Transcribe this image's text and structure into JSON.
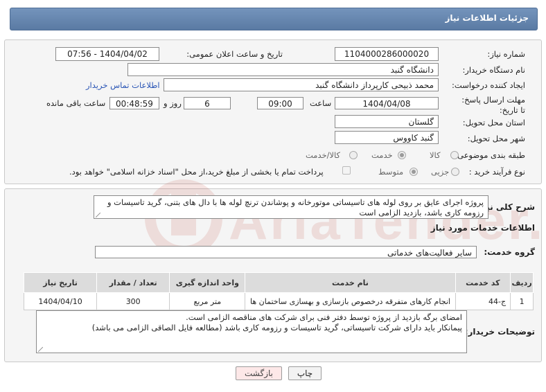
{
  "header": {
    "title": "جزئیات اطلاعات نیاز"
  },
  "need": {
    "number_label": "شماره نیاز:",
    "number": "1104000286000020",
    "announce_label": "تاریخ و ساعت اعلان عمومی:",
    "announce_value": "1404/04/02 - 07:56",
    "buyer_label": "نام دستگاه خریدار:",
    "buyer": "دانشگاه گنبد",
    "creator_label": "ایجاد کننده درخواست:",
    "creator": "محمد ذبیحی کارپرداز دانشگاه گنبد",
    "contact_link": "اطلاعات تماس خریدار",
    "deadline_label": "مهلت ارسال پاسخ: تا تاریخ:",
    "deadline_date": "1404/04/08",
    "time_label": "ساعت",
    "deadline_time": "09:00",
    "days_value": "6",
    "days_label": "روز و",
    "remaining_value": "00:48:59",
    "remaining_label": "ساعت باقی مانده",
    "province_label": "استان محل تحویل:",
    "province": "گلستان",
    "city_label": "شهر محل تحویل:",
    "city": "گنبد کاووس",
    "category_label": "طبقه بندی موضوعی:",
    "category_options": [
      "کالا",
      "خدمت",
      "کالا/خدمت"
    ],
    "category_selected": "خدمت",
    "process_label": "نوع فرآیند خرید :",
    "process_options": [
      "جزیی",
      "متوسط"
    ],
    "process_selected": "متوسط",
    "payment_note": "پرداخت تمام یا بخشی از مبلغ خرید،از محل \"اسناد خزانه اسلامی\" خواهد بود."
  },
  "summary": {
    "label": "شرح کلی نیاز:",
    "text": "پروژه اجرای عایق بر روی لوله های تاسیساتی موتورخانه و پوشاندن ترنچ لوله ها با دال های بتنی، گرید تاسیسات و رزومه کاری باشد، بازدید الزامی است"
  },
  "services": {
    "section_title": "اطلاعات خدمات مورد نیاز",
    "group_label": "گروه خدمت:",
    "group_value": "سایر فعالیت‌های خدماتی",
    "columns": [
      "ردیف",
      "کد خدمت",
      "نام خدمت",
      "واحد اندازه گیری",
      "تعداد / مقدار",
      "تاریخ نیاز"
    ],
    "rows": [
      [
        "1",
        "ج-44",
        "انجام کارهای متفرقه درخصوص بازسازی و بهسازی ساختمان ها",
        "متر مربع",
        "300",
        "1404/04/10"
      ]
    ]
  },
  "buyer_notes": {
    "label": "توضیحات خریدار:",
    "line1": "امضای برگه بازدید از پروژه توسط دفتر فنی برای شرکت های مناقصه الزامی است.",
    "line2": "پیمانکار باید دارای شرکت تاسیساتی، گرید تاسیسات و رزومه کاری باشد (مطالعه فایل الصاقی الزامی می باشد)"
  },
  "buttons": {
    "print": "چاپ",
    "back": "بازگشت"
  },
  "watermark": "AriaTender.net",
  "colors": {
    "title_bar": "#5a7aa3",
    "link": "#2a55b5",
    "back_button": "#fde8e8",
    "watermark": "#c0392b"
  }
}
